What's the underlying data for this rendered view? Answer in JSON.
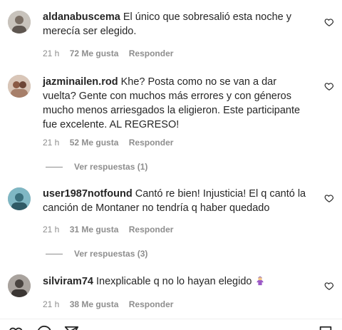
{
  "comments": [
    {
      "username": "aldanabuscema",
      "text": "El único que sobresalió esta noche y merecía ser elegido.",
      "time": "21 h",
      "likes": "72 Me gusta",
      "reply": "Responder",
      "avatar_color": "#9e9890"
    },
    {
      "username": "jazminailen.rod",
      "text": "Khe? Posta como no se van a dar vuelta? Gente con muchos más errores y con géneros mucho menos arriesgados la eligieron. Este participante fue excelente. AL REGRESO!",
      "time": "21 h",
      "likes": "52 Me gusta",
      "reply": "Responder",
      "view_replies": "Ver respuestas (1)",
      "avatar_color": "#b68d78"
    },
    {
      "username": "user1987notfound",
      "text": "Cantó re bien! Injusticia! El q cantó la canción de Montaner no tendría q haber quedado",
      "time": "21 h",
      "likes": "31 Me gusta",
      "reply": "Responder",
      "view_replies": "Ver respuestas (3)",
      "avatar_color": "#5b9aa8"
    },
    {
      "username": "silviram74",
      "text": "Inexplicable q no lo hayan elegido",
      "emoji": "shrugging-person-emoji",
      "time": "21 h",
      "likes": "38 Me gusta",
      "reply": "Responder",
      "avatar_color": "#6f6a66"
    }
  ],
  "icons": {
    "like": "heart-outline-icon",
    "bar": [
      "heart-icon",
      "comment-icon",
      "share-icon",
      "bookmark-icon"
    ]
  },
  "colors": {
    "text": "#262626",
    "meta": "#8e8e8e",
    "divider": "#efefef"
  }
}
